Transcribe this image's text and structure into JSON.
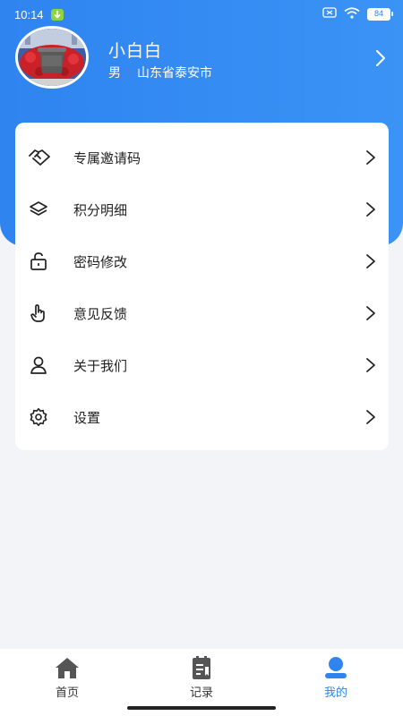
{
  "status_bar": {
    "time": "10:14",
    "battery": "84"
  },
  "profile": {
    "name": "小白白",
    "gender": "男",
    "location": "山东省泰安市"
  },
  "menu": [
    {
      "id": "invite-code",
      "label": "专属邀请码",
      "icon": "handshake-icon"
    },
    {
      "id": "points-detail",
      "label": "积分明细",
      "icon": "layers-icon"
    },
    {
      "id": "change-password",
      "label": "密码修改",
      "icon": "unlock-icon"
    },
    {
      "id": "feedback",
      "label": "意见反馈",
      "icon": "touch-icon"
    },
    {
      "id": "about-us",
      "label": "关于我们",
      "icon": "user-icon"
    },
    {
      "id": "settings",
      "label": "设置",
      "icon": "gear-icon"
    }
  ],
  "tabs": [
    {
      "label": "首页",
      "icon": "home-icon",
      "active": false
    },
    {
      "label": "记录",
      "icon": "record-icon",
      "active": false
    },
    {
      "label": "我的",
      "icon": "profile-icon",
      "active": true
    }
  ],
  "colors": {
    "primary": "#2f84f0",
    "background": "#f3f4f8",
    "card": "#ffffff"
  }
}
